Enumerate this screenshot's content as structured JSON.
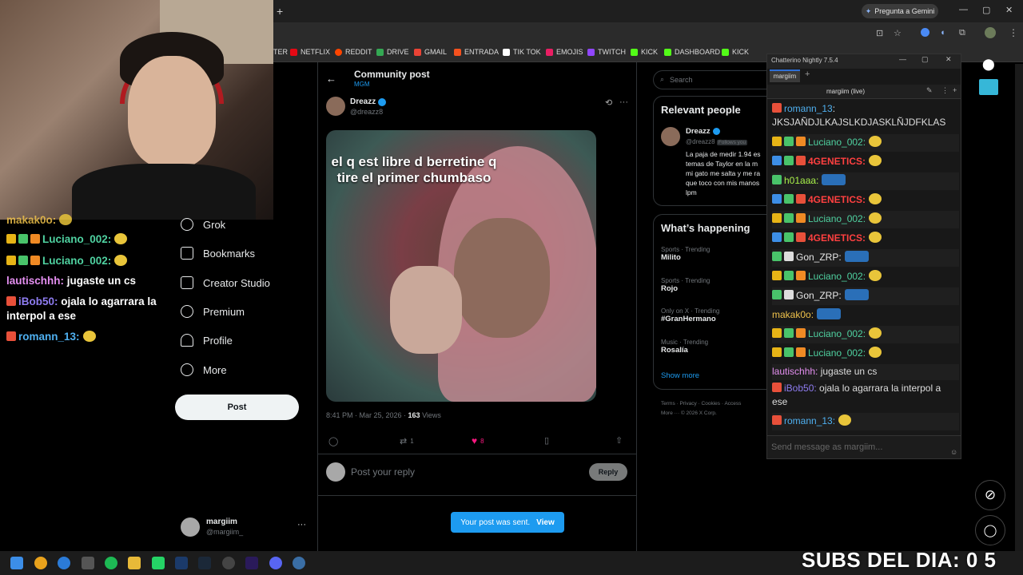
{
  "browser": {
    "gemini_button": "Pregunta a Gemini",
    "bookmarks": [
      {
        "label": "TER",
        "color": "#888888"
      },
      {
        "label": "NETFLIX",
        "color": "#e50914"
      },
      {
        "label": "REDDIT",
        "color": "#ff4500"
      },
      {
        "label": "DRIVE",
        "color": "#34a853"
      },
      {
        "label": "GMAIL",
        "color": "#ea4335"
      },
      {
        "label": "ENTRADA",
        "color": "#f4511e"
      },
      {
        "label": "TIK TOK",
        "color": "#ffffff"
      },
      {
        "label": "EMOJIS",
        "color": "#e91e63"
      },
      {
        "label": "TWITCH",
        "color": "#9146ff"
      },
      {
        "label": "KICK",
        "color": "#53fc18"
      },
      {
        "label": "DASHBOARD",
        "color": "#53fc18"
      },
      {
        "label": "KICK",
        "color": "#53fc18"
      }
    ]
  },
  "left_chat": [
    {
      "user": "makak0o:",
      "color": "#f0c24b",
      "text": "",
      "emote": true
    },
    {
      "user": "Luciano_002:",
      "color": "#4fd1a0",
      "text": "",
      "emote": true
    },
    {
      "user": "Luciano_002:",
      "color": "#4fd1a0",
      "text": "",
      "emote": true
    },
    {
      "user": "lautischhh:",
      "color": "#e48ff0",
      "text": "jugaste un cs",
      "emote": false
    },
    {
      "user": "iBob50:",
      "color": "#8e7cf0",
      "text": "ojala lo agarrara la interpol a ese",
      "emote": false
    },
    {
      "user": "romann_13:",
      "color": "#4fb0f0",
      "text": "",
      "emote": true
    }
  ],
  "x_nav": {
    "items": [
      "Grok",
      "Bookmarks",
      "Creator Studio",
      "Premium",
      "Profile",
      "More"
    ],
    "post_button": "Post",
    "account_name": "margiim",
    "account_handle": "@margiim_"
  },
  "post": {
    "header_title": "Community post",
    "header_sub": "MGM",
    "author": "Dreazz",
    "handle": "@dreazz8",
    "media_text": "el q est libre d berretine q tire el primer chumbaso",
    "timestamp": "8:41 PM · Mar 25, 2026 · ",
    "views_count": "163",
    "views_label": " Views",
    "reposts": "1",
    "likes": "8",
    "reply_placeholder": "Post your reply",
    "reply_button": "Reply",
    "toast_text": "Your post was sent.",
    "toast_link": "View"
  },
  "sidebar": {
    "search_placeholder": "Search",
    "relevant_title": "Relevant people",
    "person_name": "Dreazz",
    "person_handle": "@dreazz8",
    "follows_you": "Follows you",
    "person_bio": "La paja de medir 1.94 es temas de Taylor en la m mi gato me salta y me ra que toco con mis manos lpm",
    "happening_title": "What’s happening",
    "trends": [
      {
        "category": "Sports · Trending",
        "name": "Milito"
      },
      {
        "category": "Sports · Trending",
        "name": "Rojo"
      },
      {
        "category": "Only on X · Trending",
        "name": "#GranHermano"
      },
      {
        "category": "Music · Trending",
        "name": "Rosalía"
      }
    ],
    "show_more": "Show more",
    "footer_links": "Terms · Privacy · Cookies · Access",
    "footer_more": "More ···  © 2026 X Corp."
  },
  "chatterino": {
    "title": "Chatterino Nightly 7.5.4",
    "tab": "margiim",
    "channel_header": "margiim (live)",
    "input_placeholder": "Send message as margiim...",
    "messages": [
      {
        "user": "romann_13",
        "color": "#4fb0f0",
        "text": "JKSJAÑDJLKAJSLKDJASKLÑJDFKLAS"
      },
      {
        "user": "Luciano_002:",
        "color": "#4fd1a0",
        "text": ""
      },
      {
        "user": "4GENETICS:",
        "color": "#ff4040",
        "text": ""
      },
      {
        "user": "h01aaa:",
        "color": "#a8f04a",
        "text": ""
      },
      {
        "user": "4GENETICS:",
        "color": "#ff4040",
        "text": ""
      },
      {
        "user": "Luciano_002:",
        "color": "#4fd1a0",
        "text": ""
      },
      {
        "user": "4GENETICS:",
        "color": "#ff4040",
        "text": ""
      },
      {
        "user": "Gon_ZRP:",
        "color": "#e7e7e7",
        "text": ""
      },
      {
        "user": "Luciano_002:",
        "color": "#4fd1a0",
        "text": ""
      },
      {
        "user": "Gon_ZRP:",
        "color": "#e7e7e7",
        "text": ""
      },
      {
        "user": "makak0o:",
        "color": "#f0c24b",
        "text": ""
      },
      {
        "user": "Luciano_002:",
        "color": "#4fd1a0",
        "text": ""
      },
      {
        "user": "Luciano_002:",
        "color": "#4fd1a0",
        "text": ""
      },
      {
        "user": "lautischhh:",
        "color": "#e48ff0",
        "text": "jugaste un cs"
      },
      {
        "user": "iBob50:",
        "color": "#8e7cf0",
        "text": "ojala lo agarrara la interpol a"
      },
      {
        "user": "",
        "color": "#e7e7e7",
        "text": "ese"
      },
      {
        "user": "romann_13:",
        "color": "#4fb0f0",
        "text": ""
      }
    ]
  },
  "overlay": {
    "subs_text": "SUBS DEL DIA: 0 5"
  },
  "colors": {
    "accent": "#1d9bf0",
    "like": "#f91880"
  }
}
